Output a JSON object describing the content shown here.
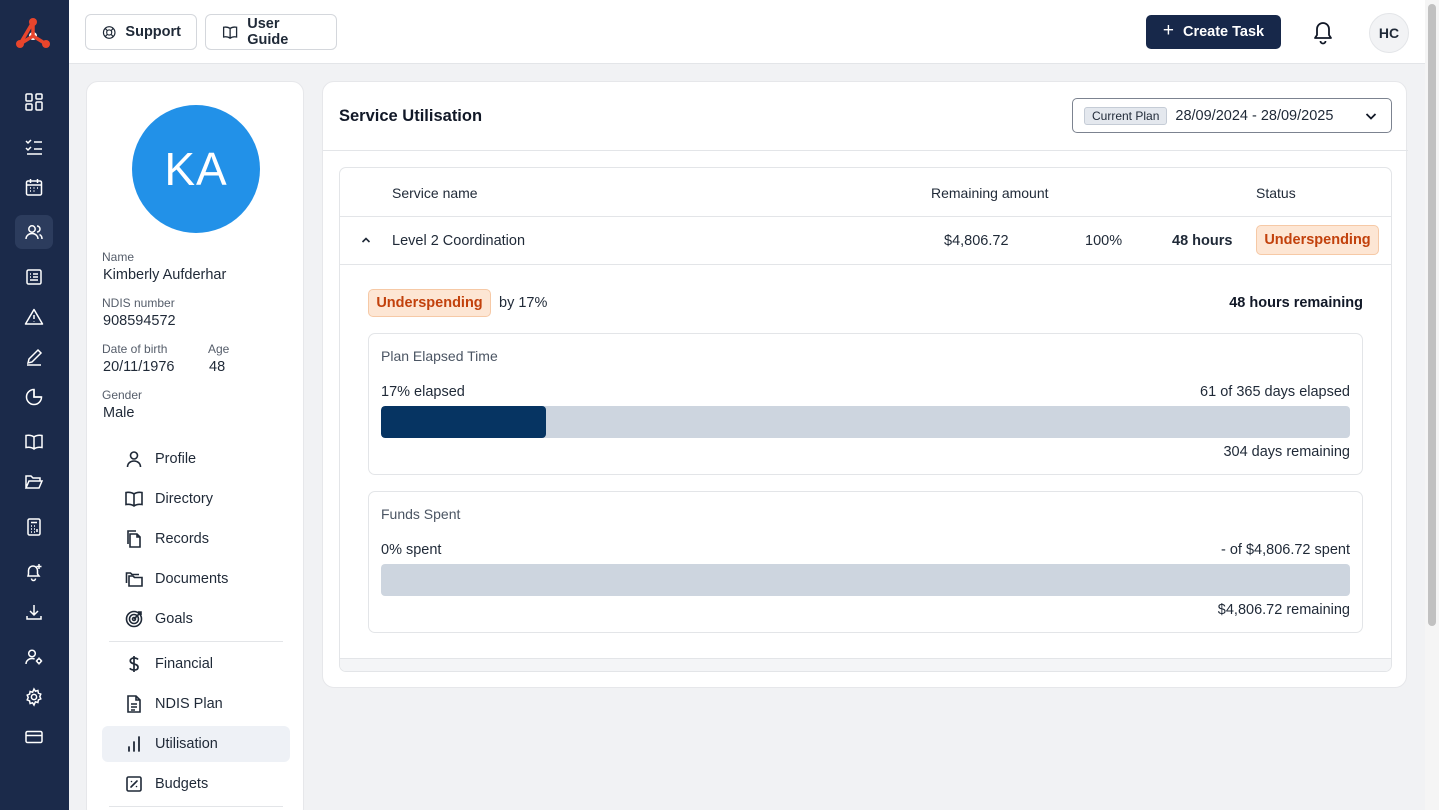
{
  "topbar": {
    "support_label": "Support",
    "user_guide_label": "User Guide",
    "create_task_label": "Create Task",
    "user_initials": "HC"
  },
  "profile": {
    "initials": "KA",
    "name_label": "Name",
    "name": "Kimberly Aufderhar",
    "ndis_label": "NDIS number",
    "ndis": "908594572",
    "dob_label": "Date of birth",
    "dob": "20/11/1976",
    "age_label": "Age",
    "age": "48",
    "gender_label": "Gender",
    "gender": "Male",
    "menu": [
      {
        "label": "Profile",
        "icon": "person-icon"
      },
      {
        "label": "Directory",
        "icon": "book-open-icon"
      },
      {
        "label": "Records",
        "icon": "files-icon"
      },
      {
        "label": "Documents",
        "icon": "folders-icon"
      },
      {
        "label": "Goals",
        "icon": "target-icon"
      },
      {
        "label": "Financial",
        "icon": "dollar-icon"
      },
      {
        "label": "NDIS Plan",
        "icon": "document-icon"
      },
      {
        "label": "Utilisation",
        "icon": "bar-chart-icon",
        "active": true
      },
      {
        "label": "Budgets",
        "icon": "budget-icon"
      }
    ]
  },
  "main": {
    "title": "Service Utilisation",
    "plan_badge": "Current Plan",
    "plan_range": "28/09/2024 - 28/09/2025",
    "columns": {
      "service_name": "Service name",
      "remaining_amount": "Remaining amount",
      "status": "Status"
    },
    "row": {
      "service_name": "Level 2 Coordination",
      "remaining_amount": "$4,806.72",
      "remaining_pct": "100%",
      "hours": "48 hours",
      "status": "Underspending"
    },
    "detail": {
      "status": "Underspending",
      "by_text": "by 17%",
      "hours_remaining": "48 hours remaining",
      "elapsed": {
        "title": "Plan Elapsed Time",
        "left": "17% elapsed",
        "right": "61 of 365 days elapsed",
        "below": "304 days remaining",
        "progress": 0.17
      },
      "funds": {
        "title": "Funds Spent",
        "left": "0% spent",
        "right": "- of $4,806.72 spent",
        "below": "$4,806.72 remaining",
        "progress": 0
      }
    }
  },
  "colors": {
    "rail": "#1b2a4a",
    "primary": "#17284a",
    "avatar": "#2291e8",
    "bar_fill": "#063462",
    "bar_track": "#cdd5df",
    "warning_bg": "#fde6d4",
    "warning_text": "#c2410c"
  }
}
